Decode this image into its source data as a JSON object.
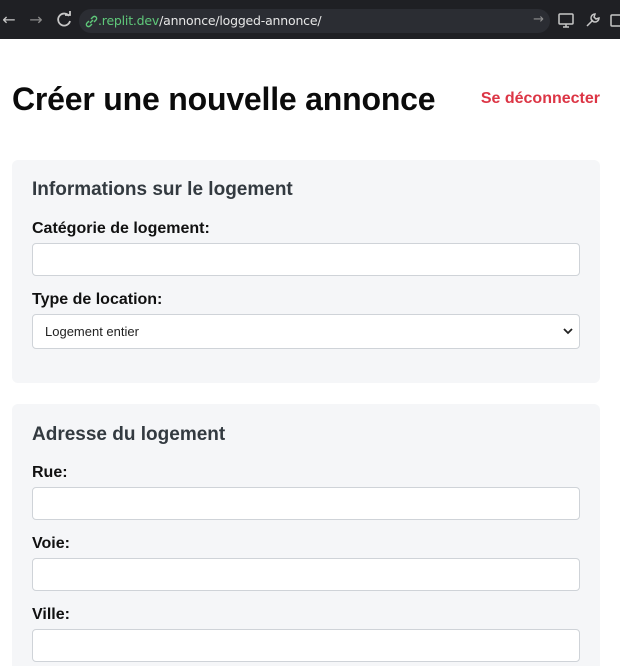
{
  "browser": {
    "url_host": ".replit.dev",
    "url_path": "/annonce/logged-annonce/"
  },
  "header": {
    "title": "Créer une nouvelle annonce",
    "logout_label": "Se déconnecter"
  },
  "sections": {
    "logement": {
      "title": "Informations sur le logement",
      "category_label": "Catégorie de logement:",
      "category_value": "",
      "rental_type_label": "Type de location:",
      "rental_type_selected": "Logement entier"
    },
    "adresse": {
      "title": "Adresse du logement",
      "rue_label": "Rue:",
      "rue_value": "",
      "voie_label": "Voie:",
      "voie_value": "",
      "ville_label": "Ville:",
      "ville_value": ""
    }
  },
  "colors": {
    "logout": "#dc3545",
    "url_host": "#5fc87a",
    "card_bg": "#f5f6f8"
  },
  "icons": [
    "back-arrow-icon",
    "forward-arrow-icon",
    "reload-icon",
    "link-icon",
    "go-arrow-icon",
    "monitor-icon",
    "wrench-icon",
    "share-icon",
    "chevron-down-icon"
  ]
}
